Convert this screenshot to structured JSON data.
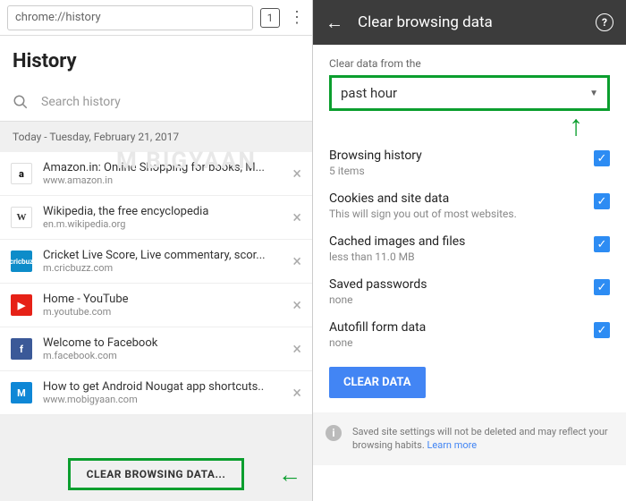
{
  "left": {
    "url": "chrome://history",
    "tabCount": "1",
    "title": "History",
    "searchPlaceholder": "Search history",
    "dateHeader": "Today - Tuesday, February 21, 2017",
    "items": [
      {
        "title": "Amazon.in: Online Shopping for books, M...",
        "url": "www.amazon.in",
        "faviconClass": "fav-amazon",
        "faviconText": "a"
      },
      {
        "title": "Wikipedia, the free encyclopedia",
        "url": "en.m.wikipedia.org",
        "faviconClass": "fav-wiki",
        "faviconText": "W"
      },
      {
        "title": "Cricket Live Score, Live commentary, scor...",
        "url": "m.cricbuzz.com",
        "faviconClass": "fav-cricbuzz",
        "faviconText": "cricbuz"
      },
      {
        "title": "Home - YouTube",
        "url": "m.youtube.com",
        "faviconClass": "fav-yt",
        "faviconText": "▶"
      },
      {
        "title": "Welcome to Facebook",
        "url": "m.facebook.com",
        "faviconClass": "fav-fb",
        "faviconText": "f"
      },
      {
        "title": "How to get Android Nougat app shortcuts..",
        "url": "www.mobigyaan.com",
        "faviconClass": "fav-m",
        "faviconText": "M"
      }
    ],
    "clearButton": "CLEAR BROWSING DATA..."
  },
  "right": {
    "toolbarTitle": "Clear browsing data",
    "rangeLabel": "Clear data from the",
    "rangeValue": "past hour",
    "options": [
      {
        "title": "Browsing history",
        "sub": "5 items"
      },
      {
        "title": "Cookies and site data",
        "sub": "This will sign you out of most websites."
      },
      {
        "title": "Cached images and files",
        "sub": "less than 11.0 MB"
      },
      {
        "title": "Saved passwords",
        "sub": "none"
      },
      {
        "title": "Autofill form data",
        "sub": "none"
      }
    ],
    "clearDataBtn": "CLEAR DATA",
    "footerText": "Saved site settings will not be deleted and may reflect your browsing habits. ",
    "learnMore": "Learn more"
  },
  "watermark": "M   BIGYAAN"
}
